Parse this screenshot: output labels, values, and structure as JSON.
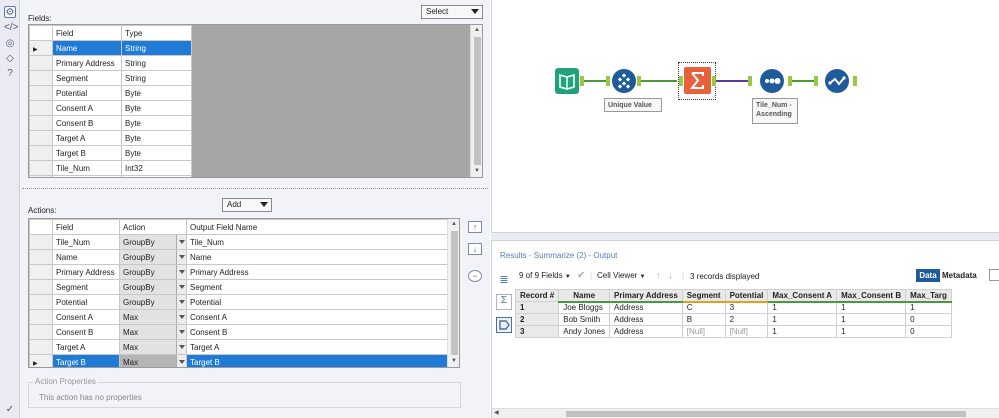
{
  "config": {
    "fields_label": "Fields:",
    "select_dropdown": "Select",
    "fields_headers": [
      "Field",
      "Type"
    ],
    "fields_rows": [
      {
        "field": "Name",
        "type": "String",
        "selected": true
      },
      {
        "field": "Primary Address",
        "type": "String",
        "selected": false
      },
      {
        "field": "Segment",
        "type": "String",
        "selected": false
      },
      {
        "field": "Potential",
        "type": "Byte",
        "selected": false
      },
      {
        "field": "Consent A",
        "type": "Byte",
        "selected": false
      },
      {
        "field": "Consent B",
        "type": "Byte",
        "selected": false
      },
      {
        "field": "Target A",
        "type": "Byte",
        "selected": false
      },
      {
        "field": "Target B",
        "type": "Byte",
        "selected": false
      },
      {
        "field": "Tile_Num",
        "type": "Int32",
        "selected": false
      }
    ],
    "actions_label": "Actions:",
    "add_dropdown": "Add",
    "actions_headers": [
      "Field",
      "Action",
      "Output Field Name"
    ],
    "actions_rows": [
      {
        "field": "Tile_Num",
        "action": "GroupBy",
        "output": "Tile_Num",
        "selected": false
      },
      {
        "field": "Name",
        "action": "GroupBy",
        "output": "Name",
        "selected": false
      },
      {
        "field": "Primary Address",
        "action": "GroupBy",
        "output": "Primary Address",
        "selected": false
      },
      {
        "field": "Segment",
        "action": "GroupBy",
        "output": "Segment",
        "selected": false
      },
      {
        "field": "Potential",
        "action": "GroupBy",
        "output": "Potential",
        "selected": false
      },
      {
        "field": "Consent A",
        "action": "Max",
        "output": "Consent A",
        "selected": false
      },
      {
        "field": "Consent B",
        "action": "Max",
        "output": "Consent B",
        "selected": false
      },
      {
        "field": "Target A",
        "action": "Max",
        "output": "Target A",
        "selected": false
      },
      {
        "field": "Target B",
        "action": "Max",
        "output": "Target B",
        "selected": true
      }
    ],
    "action_properties_title": "Action Properties",
    "action_properties_text": "This action has no properties"
  },
  "canvas": {
    "unique_label": "Unique Value",
    "sort_label": "Tile_Num -\nAscending"
  },
  "results": {
    "title": "Results - Summarize (2) - Output",
    "fields_count": "9 of 9 Fields",
    "cell_viewer": "Cell Viewer",
    "records_displayed": "3 records displayed",
    "tab_data": "Data",
    "tab_metadata": "Metadata",
    "headers": [
      "Record #",
      "Name",
      "Primary Address",
      "Segment",
      "Potential",
      "Max_Consent A",
      "Max_Consent B",
      "Max_Targ"
    ],
    "rows": [
      [
        "1",
        "Joe Bloggs",
        "Address",
        "C",
        "3",
        "1",
        "1",
        "1"
      ],
      [
        "2",
        "Bob Smith",
        "Address",
        "B",
        "2",
        "1",
        "1",
        "0"
      ],
      [
        "3",
        "Andy Jones",
        "Address",
        "[Null]",
        "[Null]",
        "1",
        "1",
        "0"
      ]
    ]
  },
  "colors": {
    "selection": "#1f7bd6",
    "accent": "#5a7ab8",
    "input_tool": "#1fa37a",
    "tool_blue": "#1f5a9a",
    "summarize_orange": "#e8613a"
  }
}
